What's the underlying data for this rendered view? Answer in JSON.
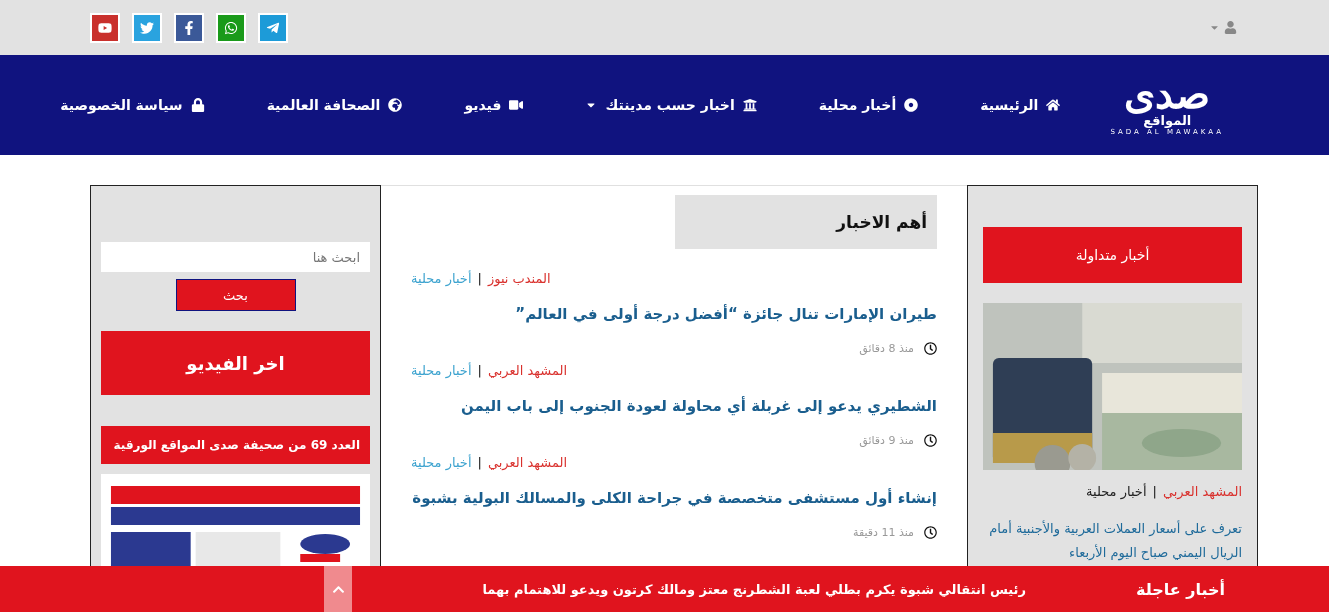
{
  "top_bar": {
    "social": [
      {
        "kind": "telegram"
      },
      {
        "kind": "whatsapp"
      },
      {
        "kind": "facebook"
      },
      {
        "kind": "twitter"
      },
      {
        "kind": "youtube"
      }
    ]
  },
  "logo": {
    "name": "صدى",
    "subtitle": "المواقع",
    "tagline": "SADA AL MAWAKAA"
  },
  "nav": [
    {
      "label": "الرئيسية",
      "kind": "home",
      "dropdown": false
    },
    {
      "label": "أخبار محلية",
      "kind": "target",
      "dropdown": false
    },
    {
      "label": "اخبار حسب مدينتك",
      "kind": "bank",
      "dropdown": true
    },
    {
      "label": "فيديو",
      "kind": "video",
      "dropdown": false
    },
    {
      "label": "الصحافة العالمية",
      "kind": "globe",
      "dropdown": false
    },
    {
      "label": "سياسة الخصوصية",
      "kind": "lock",
      "dropdown": false
    }
  ],
  "trending": {
    "heading": "أخبار متداولة",
    "separator": "|",
    "source": "المشهد العربي",
    "category": "أخبار محلية",
    "title": "تعرف على أسعار العملات العربية والأجنبية أمام الريال اليمني صباح اليوم الأربعاء"
  },
  "top_news": {
    "heading": "أهم الاخبار",
    "items": [
      {
        "source": "المندب نيوز",
        "separator": "|",
        "category": "أخبار محلية",
        "title": "طيران الإمارات تنال جائزة “أفضل درجة أولى في العالم”",
        "time": "منذ 8 دقائق"
      },
      {
        "source": "المشهد العربي",
        "separator": "|",
        "category": "أخبار محلية",
        "title": "الشطيري يدعو إلى غربلة أي محاولة لعودة الجنوب إلى باب اليمن",
        "time": "منذ 9 دقائق"
      },
      {
        "source": "المشهد العربي",
        "separator": "|",
        "category": "أخبار محلية",
        "title": "إنشاء أول مستشفى متخصصة في جراحة الكلى والمسالك البولية بشبوة",
        "time": "منذ 11 دقيقة"
      }
    ]
  },
  "sidebar": {
    "search": {
      "placeholder": "ابحث هنا",
      "button": "بحث"
    },
    "video_heading": "اخر الفيديو",
    "newspaper": {
      "heading": "العدد 69 من صحيفة صدى المواقع الورقية"
    }
  },
  "breaking": {
    "label": "أخبار عاجلة",
    "text": "رئيس انتقالي شبوة يكرم بطلي لعبة الشطرنج معتز ومالك كرتون ويدعو للاهتمام بهما"
  }
}
